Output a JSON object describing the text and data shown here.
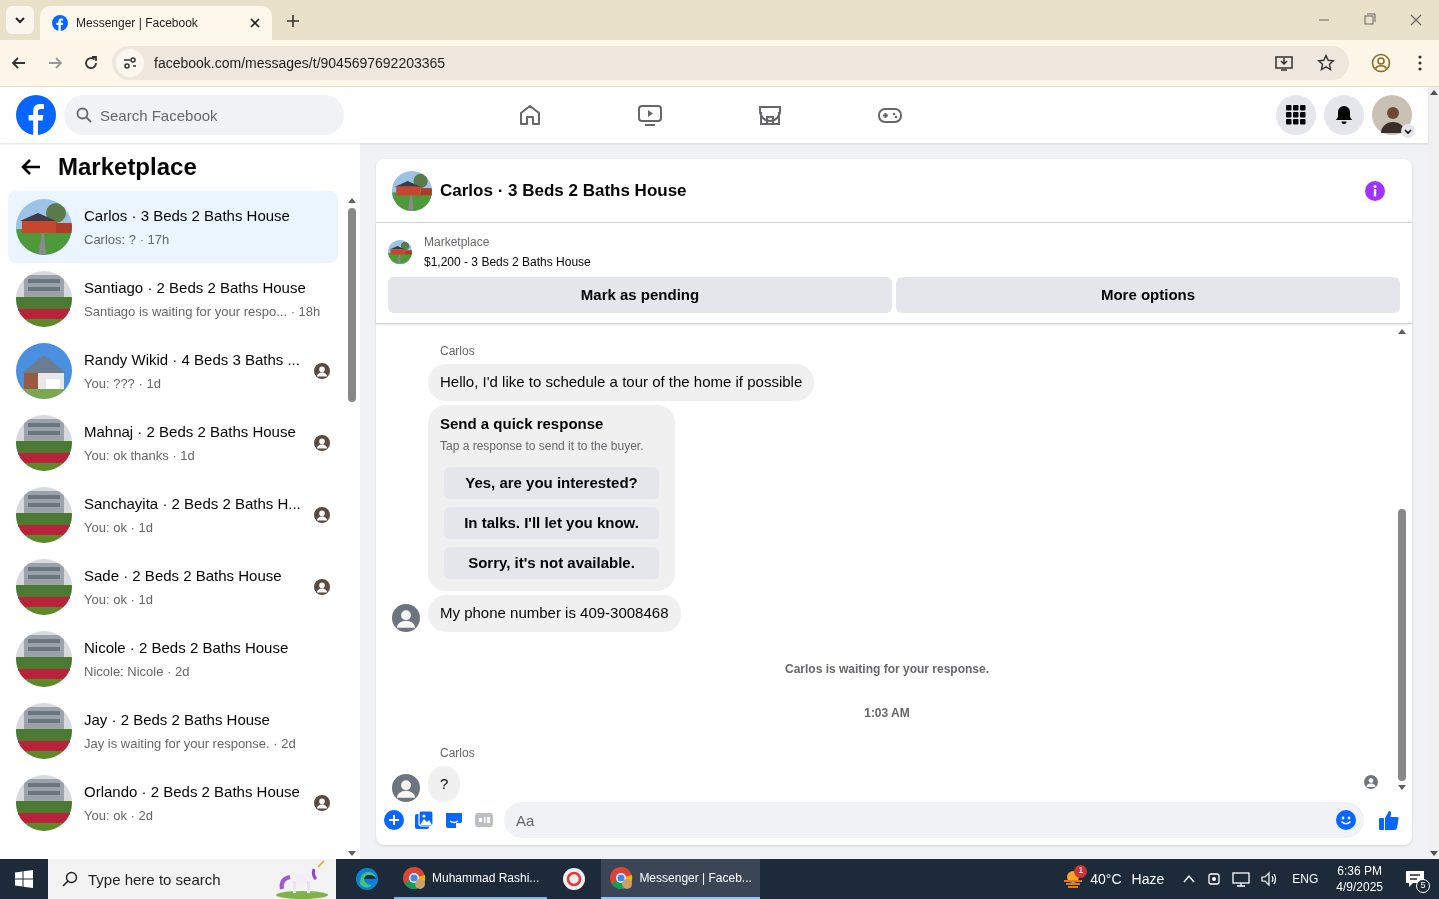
{
  "browser": {
    "tab_title": "Messenger | Facebook",
    "url": "facebook.com/messages/t/9045697692203365"
  },
  "header": {
    "search_placeholder": "Search Facebook",
    "nav": [
      {
        "kind": "home"
      },
      {
        "kind": "video"
      },
      {
        "kind": "store"
      },
      {
        "kind": "game"
      }
    ]
  },
  "sidebar": {
    "title": "Marketplace",
    "conversations": [
      {
        "title": "Carlos · 3 Beds 2 Baths House",
        "preview": "Carlos: ? · 17h",
        "selected": true,
        "kind": "redhouse",
        "seen": false
      },
      {
        "title": "Santiago · 2 Beds 2 Baths House",
        "preview": "Santiago is waiting for your respo... · 18h",
        "selected": false,
        "kind": "building",
        "seen": false
      },
      {
        "title": "Randy Wikid · 4 Beds 3 Baths ...",
        "preview": "You: ??? · 1d",
        "selected": false,
        "kind": "bluehouse",
        "seen": true
      },
      {
        "title": "Mahnaj · 2 Beds 2 Baths House",
        "preview": "You: ok thanks · 1d",
        "selected": false,
        "kind": "building",
        "seen": true
      },
      {
        "title": "Sanchayita · 2 Beds 2 Baths H...",
        "preview": "You: ok · 1d",
        "selected": false,
        "kind": "building",
        "seen": true
      },
      {
        "title": "Sade · 2 Beds 2 Baths House",
        "preview": "You: ok · 1d",
        "selected": false,
        "kind": "building",
        "seen": true
      },
      {
        "title": "Nicole · 2 Beds 2 Baths House",
        "preview": "Nicole: Nicole · 2d",
        "selected": false,
        "kind": "building",
        "seen": false
      },
      {
        "title": "Jay · 2 Beds 2 Baths House",
        "preview": "Jay is waiting for your response. · 2d",
        "selected": false,
        "kind": "building",
        "seen": false
      },
      {
        "title": "Orlando · 2 Beds 2 Baths House",
        "preview": "You: ok · 2d",
        "selected": false,
        "kind": "building",
        "seen": true
      }
    ]
  },
  "chat": {
    "title": "Carlos · 3 Beds 2 Baths House",
    "listing": {
      "label": "Marketplace",
      "text": "$1,200 - 3 Beds 2 Baths House"
    },
    "actions": [
      "Mark as pending",
      "More options"
    ],
    "messages": [
      {
        "kind": "sender",
        "text": "Carlos"
      },
      {
        "kind": "bubble",
        "text": "Hello, I'd like to schedule a tour of the home if possible",
        "avatar": false
      },
      {
        "kind": "quick",
        "title": "Send a quick response",
        "subtitle": "Tap a response to send it to the buyer.",
        "options": [
          "Yes, are you interested?",
          "In talks. I'll let you know.",
          "Sorry, it's not available."
        ]
      },
      {
        "kind": "bubble",
        "text": "My phone number is 409-3008468",
        "avatar": true
      },
      {
        "kind": "notice",
        "text": "Carlos is waiting for your response."
      },
      {
        "kind": "time",
        "text": "1:03 AM"
      },
      {
        "kind": "sender",
        "text": "Carlos"
      },
      {
        "kind": "bubble",
        "text": "?",
        "avatar": true
      }
    ],
    "composer_placeholder": "Aa"
  },
  "taskbar": {
    "search_placeholder": "Type here to search",
    "apps": [
      {
        "kind": "edge"
      },
      {
        "kind": "chrome",
        "label": "Muhammad Rashi...",
        "active": false
      },
      {
        "kind": "app"
      },
      {
        "kind": "chrome",
        "label": "Messenger | Faceb...",
        "active": true
      }
    ],
    "weather": {
      "badge": "1",
      "temp": "40°C",
      "condition": "Haze"
    },
    "language": "ENG",
    "time": "6:36 PM",
    "date": "4/9/2025",
    "notifications": "5"
  }
}
